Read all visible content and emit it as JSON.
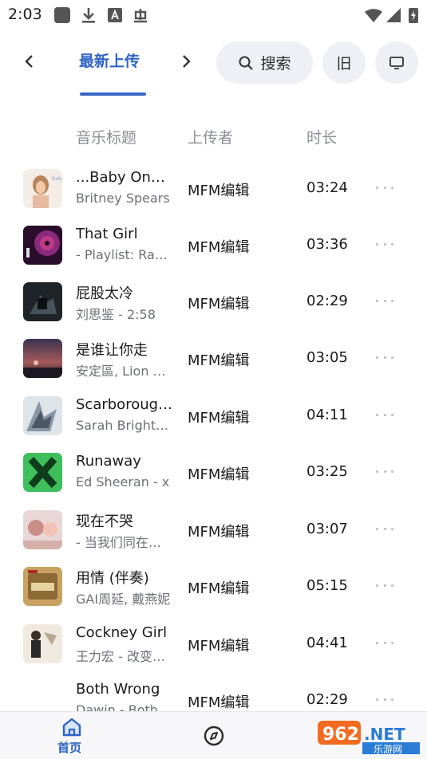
{
  "status_bar": {
    "time": "2:03"
  },
  "nav": {
    "active_tab": "最新上传",
    "search_label": "搜索",
    "old_label": "旧"
  },
  "table": {
    "headers": {
      "title": "音乐标题",
      "uploader": "上传者",
      "duration": "时长"
    },
    "rows": [
      {
        "title": "...Baby One More Time",
        "subtitle": "Britney Spears",
        "uploader": "MFM编辑",
        "duration": "03:24"
      },
      {
        "title": "That Girl",
        "subtitle": "- Playlist: Rap Chill",
        "uploader": "MFM编辑",
        "duration": "03:36"
      },
      {
        "title": "屁股太冷",
        "subtitle": "刘思鉴 - 2:58",
        "uploader": "MFM编辑",
        "duration": "02:29"
      },
      {
        "title": "是谁让你走",
        "subtitle": "安定區, Lion Bear",
        "uploader": "MFM编辑",
        "duration": "03:05"
      },
      {
        "title": "Scarborough Fair",
        "subtitle": "Sarah Brightman",
        "uploader": "MFM编辑",
        "duration": "04:11"
      },
      {
        "title": "Runaway",
        "subtitle": "Ed Sheeran - x",
        "uploader": "MFM编辑",
        "duration": "03:25"
      },
      {
        "title": "现在不哭",
        "subtitle": "- 当我们同在一起",
        "uploader": "MFM编辑",
        "duration": "03:07"
      },
      {
        "title": "用情 (伴奏)",
        "subtitle": "GAI周延, 戴燕妮",
        "uploader": "MFM编辑",
        "duration": "05:15"
      },
      {
        "title": "Cockney Girl",
        "subtitle": "王力宏 - 改变自己",
        "uploader": "MFM编辑",
        "duration": "04:41"
      },
      {
        "title": "Both Wrong",
        "subtitle": "Dawin - Both Wrong",
        "uploader": "MFM编辑",
        "duration": "02:29"
      }
    ]
  },
  "bottom_nav": {
    "home_label": "首页"
  },
  "icons": {
    "back": "chevron-left-icon",
    "forward": "chevron-right-icon",
    "search": "search-icon",
    "tv": "monitor-icon",
    "home": "home-icon",
    "discover": "compass-icon",
    "more": "more-icon"
  },
  "colors": {
    "accent": "#2e63c7",
    "header_text": "#8b8e96",
    "pill_bg": "#eef0f5"
  },
  "watermark": {
    "number": "962",
    "suffix": ".NET",
    "cn": "乐游网"
  }
}
